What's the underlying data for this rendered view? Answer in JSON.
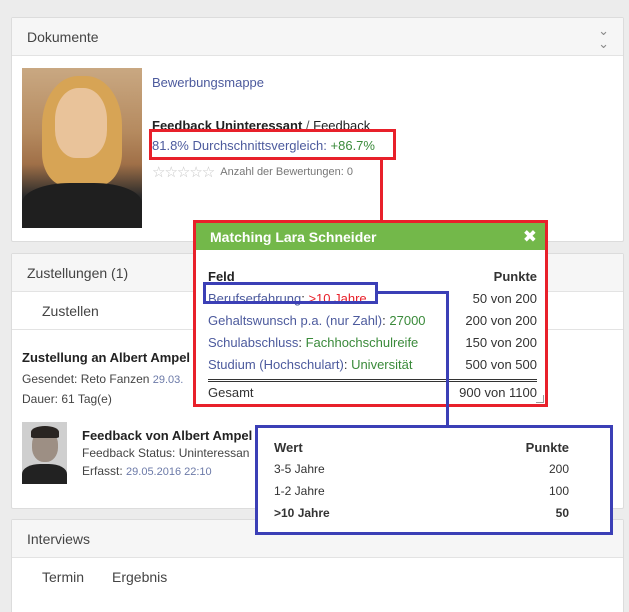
{
  "documents": {
    "title": "Dokumente",
    "collapse_icon": "double-chevron-down-icon",
    "link": "Bewerbungsmappe",
    "feedback_a": "Feedback Uninteressant",
    "feedback_sep": " / ",
    "feedback_b": "Feedback",
    "percent": "81.8%",
    "compare_label": "Durchschnittsvergleich:",
    "compare_value": "+86.7%",
    "stars": "☆☆☆☆☆",
    "rating_count": "Anzahl der Bewertungen: 0"
  },
  "deliveries": {
    "title": "Zustellungen (1)",
    "tab": "Zustellen",
    "entry_title": "Zustellung an Albert Ampel",
    "sent_label": "Gesendet: Reto Fanzen",
    "sent_date": "29.03.",
    "duration": "Dauer: 61 Tag(e)",
    "feedback_title": "Feedback von Albert Ampel",
    "feedback_status": "Feedback Status: Uninteressan",
    "created_label": "Erfasst:",
    "created_date": "29.05.2016 22:10"
  },
  "interviews": {
    "title": "Interviews",
    "tabs": [
      "Termin",
      "Ergebnis"
    ]
  },
  "matching": {
    "title": "Matching Lara Schneider",
    "close_icon": "close-icon",
    "col_field": "Feld",
    "col_points": "Punkte",
    "rows": [
      {
        "key": "Berufserfahrung",
        "value": ">10 Jahre",
        "points": "50 von 200",
        "value_color": "red"
      },
      {
        "key": "Gehaltswunsch p.a. (nur Zahl)",
        "value": "27000",
        "points": "200 von 200",
        "value_color": "green"
      },
      {
        "key": "Schulabschluss",
        "value": "Fachhochschulreife",
        "points": "150 von 200",
        "value_color": "green"
      },
      {
        "key": "Studium (Hochschulart)",
        "value": "Universität",
        "points": "500 von 500",
        "value_color": "green"
      }
    ],
    "total_label": "Gesamt",
    "total_points": "900 von 1100"
  },
  "wert": {
    "col_value": "Wert",
    "col_points": "Punkte",
    "rows": [
      {
        "label": "3-5 Jahre",
        "points": "200"
      },
      {
        "label": "1-2 Jahre",
        "points": "100"
      },
      {
        "label": ">10 Jahre",
        "points": "50"
      }
    ]
  },
  "colors": {
    "highlight_red": "#e8202a",
    "highlight_blue": "#3b3fb6",
    "popup_header": "#73b84a",
    "link": "#4c5a9d",
    "positive": "#3a8a3a"
  }
}
